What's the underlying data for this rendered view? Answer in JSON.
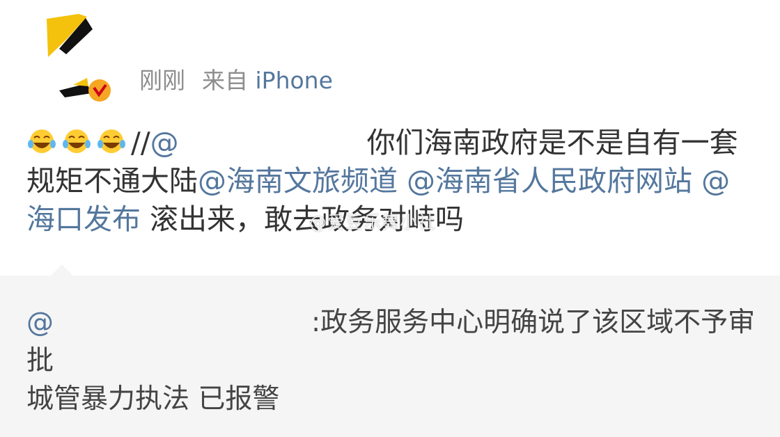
{
  "post": {
    "time": "刚刚",
    "source_prefix": "来自",
    "device": "iPhone",
    "emoji_name": "laughing-crying-emoji",
    "separator": "//",
    "mention_partial": "@",
    "text_1": "你们海南政府是不是自有一套规矩不通大陆",
    "mention_1": "@海南文旅频道",
    "mention_2": "@海南省人民政府网站",
    "mention_3": "@海口发布",
    "text_2": "滚出来，敢去政务对峙吗"
  },
  "repost": {
    "at": "@",
    "text": ":政务服务中心明确说了该区域不予审批",
    "line_2": "城管暴力执法 已报警"
  },
  "watermark": "@爱豆乐舞小社",
  "colors": {
    "link": "#54779d",
    "meta": "#8d8d8d",
    "repost_bg": "#f5f5f5",
    "badge": "#f5a623"
  }
}
